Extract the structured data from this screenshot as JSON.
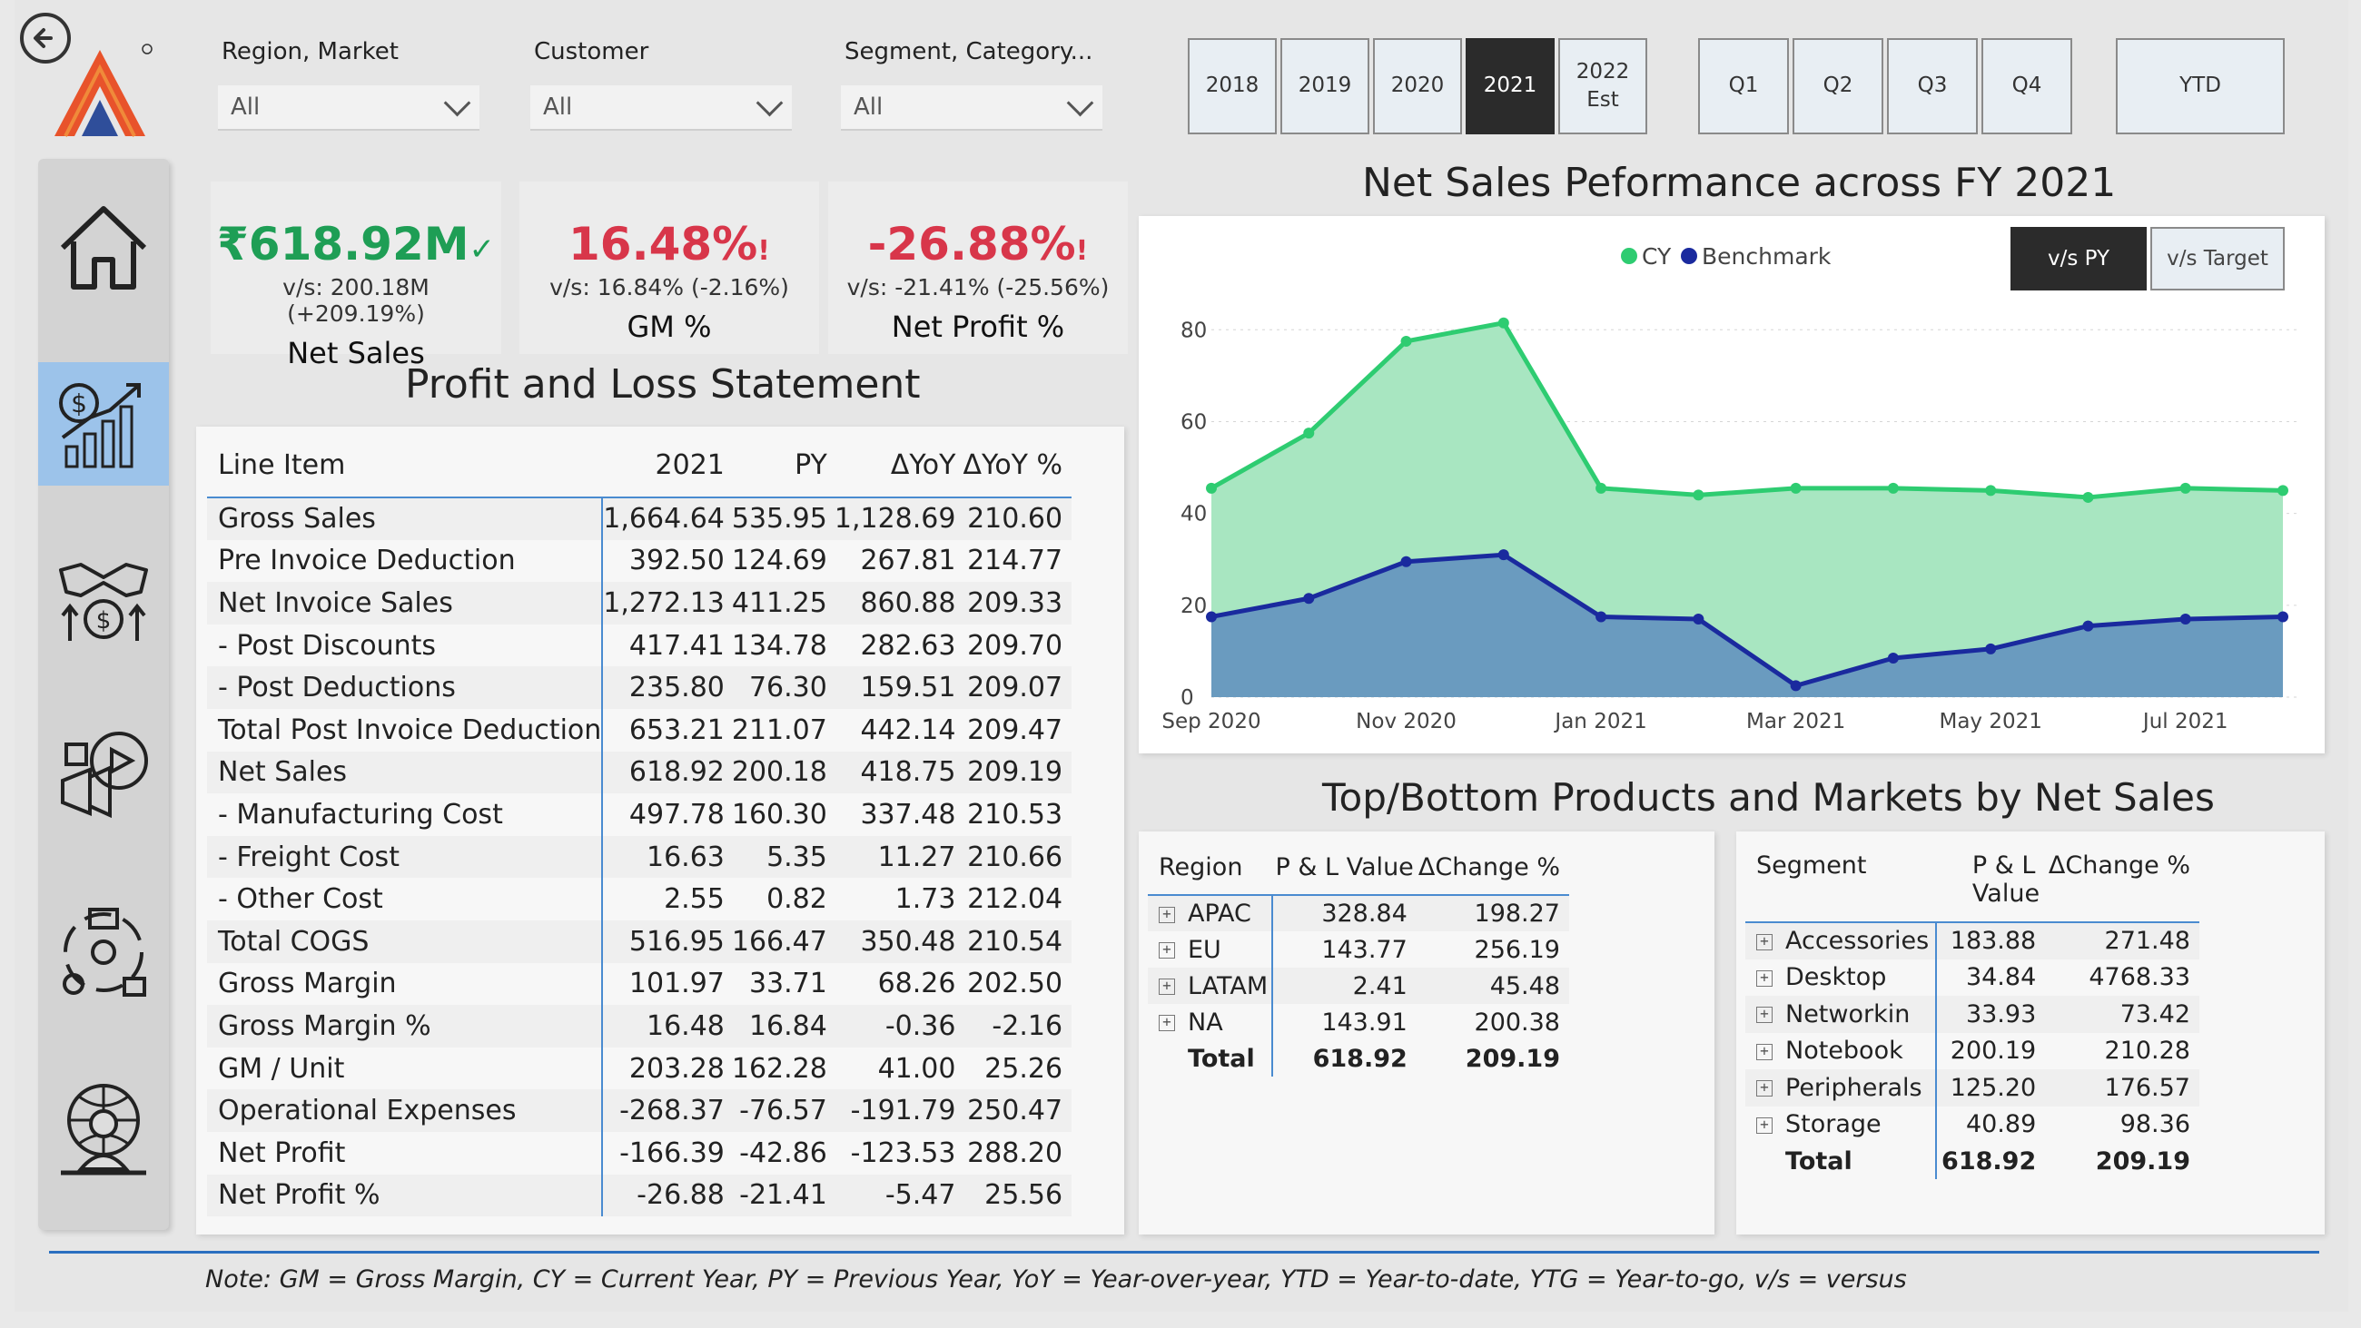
{
  "filters": [
    {
      "label": "Region, Market",
      "value": "All"
    },
    {
      "label": "Customer",
      "value": "All"
    },
    {
      "label": "Segment, Category...",
      "value": "All"
    }
  ],
  "year_slicers": [
    "2018",
    "2019",
    "2020",
    "2021",
    "2022\nEst"
  ],
  "year_selected": "2021",
  "quarter_slicers": [
    "Q1",
    "Q2",
    "Q3",
    "Q4"
  ],
  "ytd_label": "YTD",
  "kpis": [
    {
      "value": "₹618.92M",
      "mark": "✓",
      "sub": "v/s: 200.18M (+209.19%)",
      "label": "Net Sales",
      "color": "#1e9e55"
    },
    {
      "value": "16.48%",
      "mark": "!",
      "sub": "v/s: 16.84% (-2.16%)",
      "label": "GM %",
      "color": "#d8364a"
    },
    {
      "value": "-26.88%",
      "mark": "!",
      "sub": "v/s: -21.41% (-25.56%)",
      "label": "Net Profit %",
      "color": "#d8364a"
    }
  ],
  "pl": {
    "title": "Profit and Loss Statement",
    "headers": [
      "Line Item",
      "2021",
      "PY",
      "ΔYoY",
      "ΔYoY %"
    ],
    "rows": [
      [
        "Gross Sales",
        "1,664.64",
        "535.95",
        "1,128.69",
        "210.60"
      ],
      [
        "Pre Invoice Deduction",
        "392.50",
        "124.69",
        "267.81",
        "214.77"
      ],
      [
        "Net Invoice Sales",
        "1,272.13",
        "411.25",
        "860.88",
        "209.33"
      ],
      [
        "- Post Discounts",
        "417.41",
        "134.78",
        "282.63",
        "209.70"
      ],
      [
        "- Post Deductions",
        "235.80",
        "76.30",
        "159.51",
        "209.07"
      ],
      [
        "Total Post Invoice Deduction",
        "653.21",
        "211.07",
        "442.14",
        "209.47"
      ],
      [
        "Net Sales",
        "618.92",
        "200.18",
        "418.75",
        "209.19"
      ],
      [
        "- Manufacturing Cost",
        "497.78",
        "160.30",
        "337.48",
        "210.53"
      ],
      [
        "- Freight Cost",
        "16.63",
        "5.35",
        "11.27",
        "210.66"
      ],
      [
        "- Other Cost",
        "2.55",
        "0.82",
        "1.73",
        "212.04"
      ],
      [
        "Total COGS",
        "516.95",
        "166.47",
        "350.48",
        "210.54"
      ],
      [
        "Gross Margin",
        "101.97",
        "33.71",
        "68.26",
        "202.50"
      ],
      [
        "Gross Margin %",
        "16.48",
        "16.84",
        "-0.36",
        "-2.16"
      ],
      [
        "GM / Unit",
        "203.28",
        "162.28",
        "41.00",
        "25.26"
      ],
      [
        "Operational Expenses",
        "-268.37",
        "-76.57",
        "-191.79",
        "250.47"
      ],
      [
        "Net Profit",
        "-166.39",
        "-42.86",
        "-123.53",
        "288.20"
      ],
      [
        "Net Profit %",
        "-26.88",
        "-21.41",
        "-5.47",
        "25.56"
      ]
    ]
  },
  "chart_title": "Net Sales Peformance across FY 2021",
  "chart_toggle": {
    "active": "v/s PY",
    "inactive": "v/s Target"
  },
  "chart_data": {
    "type": "area",
    "x": [
      "Sep 2020",
      "Oct 2020",
      "Nov 2020",
      "Dec 2020",
      "Jan 2021",
      "Feb 2021",
      "Mar 2021",
      "Apr 2021",
      "May 2021",
      "Jun 2021",
      "Jul 2021",
      "Aug 2021"
    ],
    "x_tick_labels": [
      "Sep 2020",
      "Nov 2020",
      "Jan 2021",
      "Mar 2021",
      "May 2021",
      "Jul 2021"
    ],
    "series": [
      {
        "name": "CY",
        "color": "#2ecc71",
        "fill": "#a8e6c1",
        "values": [
          45.5,
          57.5,
          77.5,
          81.5,
          45.5,
          44,
          45.5,
          45.5,
          45,
          43.5,
          45.5,
          45
        ]
      },
      {
        "name": "Benchmark",
        "color": "#1a2a9e",
        "fill": "#6a9bbf",
        "values": [
          17.5,
          21.5,
          29.5,
          31,
          17.5,
          17,
          2.5,
          8.5,
          10.5,
          15.5,
          17,
          17.5
        ]
      }
    ],
    "ylim": [
      0,
      85
    ],
    "yticks": [
      0,
      20,
      40,
      60,
      80
    ],
    "grid": true,
    "legend": "top-center"
  },
  "tb_title": "Top/Bottom Products and Markets by Net Sales",
  "region_table": {
    "headers": [
      "Region",
      "P & L Value",
      "ΔChange %"
    ],
    "rows": [
      [
        "APAC",
        "328.84",
        "198.27"
      ],
      [
        "EU",
        "143.77",
        "256.19"
      ],
      [
        "LATAM",
        "2.41",
        "45.48"
      ],
      [
        "NA",
        "143.91",
        "200.38"
      ]
    ],
    "total": [
      "Total",
      "618.92",
      "209.19"
    ]
  },
  "segment_table": {
    "headers": [
      "Segment",
      "P & L\nValue",
      "ΔChange %"
    ],
    "rows": [
      [
        "Accessories",
        "183.88",
        "271.48"
      ],
      [
        "Desktop",
        "34.84",
        "4768.33"
      ],
      [
        "Networkin",
        "33.93",
        "73.42"
      ],
      [
        "Notebook",
        "200.19",
        "210.28"
      ],
      [
        "Peripherals",
        "125.20",
        "176.57"
      ],
      [
        "Storage",
        "40.89",
        "98.36"
      ]
    ],
    "total": [
      "Total",
      "618.92",
      "209.19"
    ]
  },
  "note": "Note: GM = Gross Margin, CY = Current Year, PY = Previous Year, YoY = Year-over-year, YTD = Year-to-date, YTG = Year-to-go, v/s = versus",
  "nav_icons": [
    "home-icon",
    "finance-growth-icon",
    "handshake-money-icon",
    "marketing-icon",
    "supply-chain-icon",
    "executive-icon"
  ]
}
